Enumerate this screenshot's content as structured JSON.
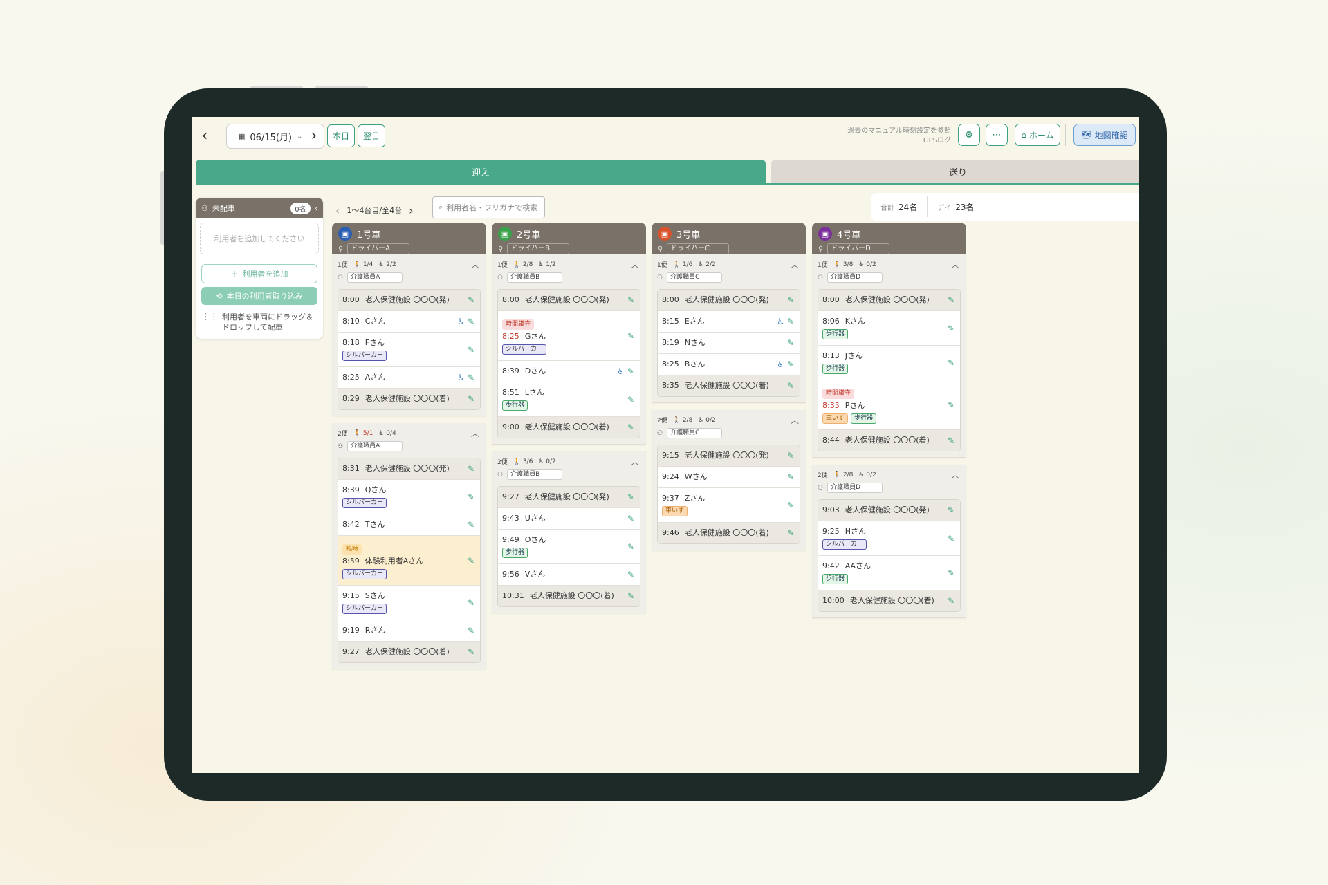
{
  "top_bar": {
    "date": "06/15(月)",
    "today_label": "本日",
    "next_day_label": "翌日",
    "past_manual_link": "過去のマニュアル時刻設定を参照",
    "gps_log_link": "GPSログ",
    "home_label": "ホーム",
    "map_label": "地図確認"
  },
  "tabs": {
    "pickup": "迎え",
    "dropoff": "送り"
  },
  "unassigned": {
    "title": "未配車",
    "count": "0名",
    "drop_placeholder": "利用者を追加してください",
    "add_user_label": "利用者を追加",
    "import_label": "本日の利用者取り込み",
    "hint": "利用者を車両にドラッグ＆ドロップして配車"
  },
  "pager": {
    "label": "1〜4台目/全4台"
  },
  "search": {
    "placeholder": "利用者名・フリガナで検索"
  },
  "totals": {
    "total_key": "合計",
    "total_value": "24名",
    "day_key": "デイ",
    "day_value": "23名"
  },
  "vehicles": [
    {
      "name": "1号車",
      "driver": "ドライバーA",
      "color": "#2b5fb4",
      "trips": [
        {
          "label": "1便",
          "walk": "1/4",
          "wheelchair": "2/2",
          "walk_over": false,
          "staff": "介護職員A",
          "stops": [
            {
              "time": "8:00",
              "name": "老人保健施設 〇〇〇(発)",
              "type": "facility"
            },
            {
              "time": "8:10",
              "name": "Cさん",
              "wheelchair": true
            },
            {
              "time": "8:18",
              "name": "Fさん",
              "tags": [
                {
                  "label": "シルバーカー",
                  "kind": "silver"
                }
              ]
            },
            {
              "time": "8:25",
              "name": "Aさん",
              "wheelchair": true
            },
            {
              "time": "8:29",
              "name": "老人保健施設 〇〇〇(着)",
              "type": "facility"
            }
          ]
        },
        {
          "label": "2便",
          "walk": "5/1",
          "wheelchair": "0/4",
          "walk_over": true,
          "staff": "介護職員A",
          "stops": [
            {
              "time": "8:31",
              "name": "老人保健施設 〇〇〇(発)",
              "type": "facility"
            },
            {
              "time": "8:39",
              "name": "Qさん",
              "tags": [
                {
                  "label": "シルバーカー",
                  "kind": "silver"
                }
              ]
            },
            {
              "time": "8:42",
              "name": "Tさん"
            },
            {
              "time": "8:59",
              "name": "体験利用者Aさん",
              "type": "trial",
              "pretag": {
                "label": "臨時",
                "kind": "temp"
              },
              "tags": [
                {
                  "label": "シルバーカー",
                  "kind": "silver"
                }
              ]
            },
            {
              "time": "9:15",
              "name": "Sさん",
              "tags": [
                {
                  "label": "シルバーカー",
                  "kind": "silver"
                }
              ]
            },
            {
              "time": "9:19",
              "name": "Rさん"
            },
            {
              "time": "9:27",
              "name": "老人保健施設 〇〇〇(着)",
              "type": "facility"
            }
          ]
        }
      ]
    },
    {
      "name": "2号車",
      "driver": "ドライバーB",
      "color": "#3aa24a",
      "trips": [
        {
          "label": "1便",
          "walk": "2/8",
          "wheelchair": "1/2",
          "walk_over": false,
          "staff": "介護職員B",
          "stops": [
            {
              "time": "8:00",
              "name": "老人保健施設 〇〇〇(発)",
              "type": "facility"
            },
            {
              "time": "8:25",
              "name": "Gさん",
              "red_time": true,
              "pretag": {
                "label": "時間厳守",
                "kind": "time"
              },
              "tags": [
                {
                  "label": "シルバーカー",
                  "kind": "silver"
                }
              ]
            },
            {
              "time": "8:39",
              "name": "Dさん",
              "wheelchair": true
            },
            {
              "time": "8:51",
              "name": "Lさん",
              "tags": [
                {
                  "label": "歩行器",
                  "kind": "walker"
                }
              ]
            },
            {
              "time": "9:00",
              "name": "老人保健施設 〇〇〇(着)",
              "type": "facility"
            }
          ]
        },
        {
          "label": "2便",
          "walk": "3/6",
          "wheelchair": "0/2",
          "walk_over": false,
          "staff": "介護職員B",
          "stops": [
            {
              "time": "9:27",
              "name": "老人保健施設 〇〇〇(発)",
              "type": "facility"
            },
            {
              "time": "9:43",
              "name": "Uさん"
            },
            {
              "time": "9:49",
              "name": "Oさん",
              "tags": [
                {
                  "label": "歩行器",
                  "kind": "walker"
                }
              ]
            },
            {
              "time": "9:56",
              "name": "Vさん"
            },
            {
              "time": "10:31",
              "name": "老人保健施設 〇〇〇(着)",
              "type": "facility"
            }
          ]
        }
      ]
    },
    {
      "name": "3号車",
      "driver": "ドライバーC",
      "color": "#d8532b",
      "trips": [
        {
          "label": "1便",
          "walk": "1/6",
          "wheelchair": "2/2",
          "walk_over": false,
          "staff": "介護職員C",
          "stops": [
            {
              "time": "8:00",
              "name": "老人保健施設 〇〇〇(発)",
              "type": "facility"
            },
            {
              "time": "8:15",
              "name": "Eさん",
              "wheelchair": true
            },
            {
              "time": "8:19",
              "name": "Nさん"
            },
            {
              "time": "8:25",
              "name": "Bさん",
              "wheelchair": true
            },
            {
              "time": "8:35",
              "name": "老人保健施設 〇〇〇(着)",
              "type": "facility"
            }
          ]
        },
        {
          "label": "2便",
          "walk": "2/8",
          "wheelchair": "0/2",
          "walk_over": false,
          "staff": "介護職員C",
          "stops": [
            {
              "time": "9:15",
              "name": "老人保健施設 〇〇〇(発)",
              "type": "facility"
            },
            {
              "time": "9:24",
              "name": "Wさん"
            },
            {
              "time": "9:37",
              "name": "Zさん",
              "tags": [
                {
                  "label": "車いす",
                  "kind": "wheel"
                }
              ]
            },
            {
              "time": "9:46",
              "name": "老人保健施設 〇〇〇(着)",
              "type": "facility"
            }
          ]
        }
      ]
    },
    {
      "name": "4号車",
      "driver": "ドライバーD",
      "color": "#7b2f9a",
      "trips": [
        {
          "label": "1便",
          "walk": "3/8",
          "wheelchair": "0/2",
          "walk_over": false,
          "staff": "介護職員D",
          "stops": [
            {
              "time": "8:00",
              "name": "老人保健施設 〇〇〇(発)",
              "type": "facility"
            },
            {
              "time": "8:06",
              "name": "Kさん",
              "tags": [
                {
                  "label": "歩行器",
                  "kind": "walker"
                }
              ]
            },
            {
              "time": "8:13",
              "name": "Jさん",
              "tags": [
                {
                  "label": "歩行器",
                  "kind": "walker"
                }
              ]
            },
            {
              "time": "8:35",
              "name": "Pさん",
              "red_time": true,
              "pretag": {
                "label": "時間厳守",
                "kind": "time"
              },
              "tags": [
                {
                  "label": "車いす",
                  "kind": "wheel"
                },
                {
                  "label": "歩行器",
                  "kind": "walker"
                }
              ]
            },
            {
              "time": "8:44",
              "name": "老人保健施設 〇〇〇(着)",
              "type": "facility"
            }
          ]
        },
        {
          "label": "2便",
          "walk": "2/8",
          "wheelchair": "0/2",
          "walk_over": false,
          "staff": "介護職員D",
          "stops": [
            {
              "time": "9:03",
              "name": "老人保健施設 〇〇〇(発)",
              "type": "facility"
            },
            {
              "time": "9:25",
              "name": "Hさん",
              "tags": [
                {
                  "label": "シルバーカー",
                  "kind": "silver"
                }
              ]
            },
            {
              "time": "9:42",
              "name": "AAさん",
              "tags": [
                {
                  "label": "歩行器",
                  "kind": "walker"
                }
              ]
            },
            {
              "time": "10:00",
              "name": "老人保健施設 〇〇〇(着)",
              "type": "facility"
            }
          ]
        }
      ]
    }
  ]
}
